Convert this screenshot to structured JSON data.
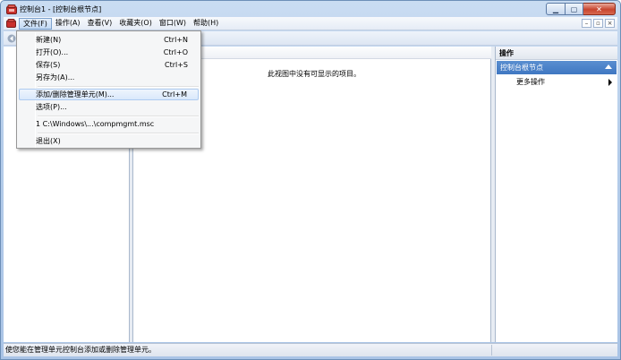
{
  "window": {
    "title": "控制台1 - [控制台根节点]"
  },
  "menubar": {
    "items": [
      {
        "label": "文件(F)",
        "active": true
      },
      {
        "label": "操作(A)"
      },
      {
        "label": "查看(V)"
      },
      {
        "label": "收藏夹(O)"
      },
      {
        "label": "窗口(W)"
      },
      {
        "label": "帮助(H)"
      }
    ]
  },
  "file_menu": {
    "new": {
      "label": "新建(N)",
      "shortcut": "Ctrl+N"
    },
    "open": {
      "label": "打开(O)...",
      "shortcut": "Ctrl+O"
    },
    "save": {
      "label": "保存(S)",
      "shortcut": "Ctrl+S"
    },
    "save_as": {
      "label": "另存为(A)..."
    },
    "add_remove_snapin": {
      "label": "添加/删除管理单元(M)...",
      "shortcut": "Ctrl+M"
    },
    "options": {
      "label": "选项(P)..."
    },
    "recent_file": {
      "label": "1 C:\\Windows\\...\\compmgmt.msc"
    },
    "exit": {
      "label": "退出(X)"
    }
  },
  "center": {
    "empty_message": "此视图中没有可显示的项目。"
  },
  "actions": {
    "title": "操作",
    "section": "控制台根节点",
    "more": "更多操作"
  },
  "statusbar": {
    "text": "使您能在管理单元控制台添加或删除管理单元。"
  },
  "colors": {
    "highlight_section": "#3f77c2",
    "close_button": "#c7452f",
    "menu_highlight": "#d9e8fb"
  }
}
